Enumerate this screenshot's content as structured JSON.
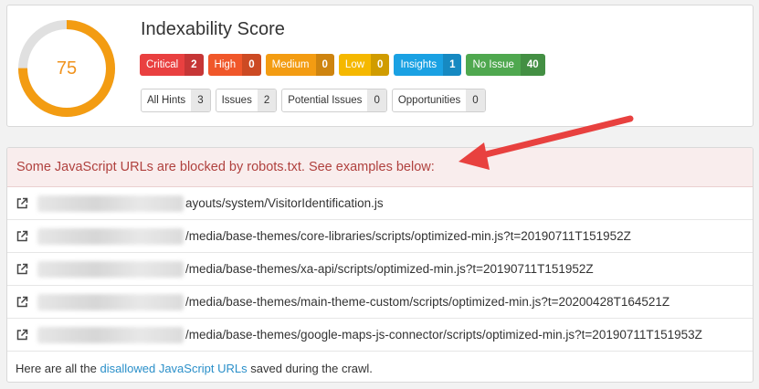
{
  "score": {
    "value": "75",
    "fraction": 0.75,
    "ring_color": "#f39c12",
    "track_color": "#e0e0e0"
  },
  "title": "Indexability Score",
  "badges": [
    {
      "label": "Critical",
      "count": "2",
      "color": "#e94040"
    },
    {
      "label": "High",
      "count": "0",
      "color": "#f0572a"
    },
    {
      "label": "Medium",
      "count": "0",
      "color": "#f39c12"
    },
    {
      "label": "Low",
      "count": "0",
      "color": "#f5b800"
    },
    {
      "label": "Insights",
      "count": "1",
      "color": "#1aa1e3"
    },
    {
      "label": "No Issue",
      "count": "40",
      "color": "#4fa84f"
    }
  ],
  "hints": [
    {
      "label": "All Hints",
      "count": "3"
    },
    {
      "label": "Issues",
      "count": "2"
    },
    {
      "label": "Potential Issues",
      "count": "0"
    },
    {
      "label": "Opportunities",
      "count": "0"
    }
  ],
  "alert": "Some JavaScript URLs are blocked by robots.txt. See examples below:",
  "urls": [
    "ayouts/system/VisitorIdentification.js",
    "/media/base-themes/core-libraries/scripts/optimized-min.js?t=20190711T151952Z",
    "/media/base-themes/xa-api/scripts/optimized-min.js?t=20190711T151952Z",
    "/media/base-themes/main-theme-custom/scripts/optimized-min.js?t=20200428T164521Z",
    "/media/base-themes/google-maps-js-connector/scripts/optimized-min.js?t=20190711T151953Z"
  ],
  "footer": {
    "before": "Here are all the ",
    "link": "disallowed JavaScript URLs",
    "after": " saved during the crawl."
  },
  "arrow_color": "#e8413f",
  "link_color": "#2a8fc9"
}
